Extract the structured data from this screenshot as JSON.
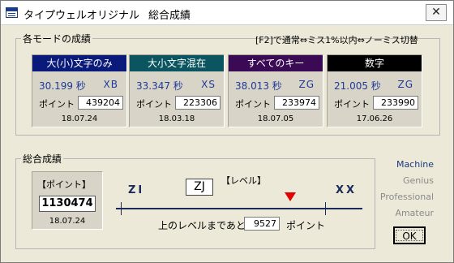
{
  "window": {
    "title": "タイプウェルオリジナル",
    "subtitle": "総合成績",
    "close_glyph": "✕"
  },
  "modes_section": {
    "legend": "各モードの成績",
    "hint": "[F2]で通常⇔ミス1%以内⇔ノーミス切替",
    "point_label": "ポイント",
    "modes": [
      {
        "name": "大(小)文字のみ",
        "header_color": "#0a1a7a",
        "time": "30.199 秒",
        "rank": "XB",
        "points": "439204",
        "date": "18.07.24"
      },
      {
        "name": "大小文字混在",
        "header_color": "#0a5560",
        "time": "33.347 秒",
        "rank": "XS",
        "points": "223306",
        "date": "18.03.18"
      },
      {
        "name": "すべてのキー",
        "header_color": "#3a0a55",
        "time": "38.013 秒",
        "rank": "ZG",
        "points": "233974",
        "date": "18.07.05"
      },
      {
        "name": "数字",
        "header_color": "#000000",
        "time": "21.005 秒",
        "rank": "ZG",
        "points": "233990",
        "date": "17.06.26"
      }
    ]
  },
  "overall_section": {
    "legend": "総合成績",
    "total_label": "【ポイント】",
    "total_points": "1130474",
    "total_date": "18.07.24",
    "level_caption": "【レベル】",
    "current_level": "ZJ",
    "lower_level": "ZI",
    "upper_level": "XX",
    "progress_to_next": 0.83,
    "next_level_prefix": "上のレベルまであと",
    "next_level_points": "9527",
    "next_level_suffix": "ポイント",
    "marker_color": "#e20000"
  },
  "rank_categories": [
    {
      "label": "Machine",
      "color": "#1a3a7a",
      "active": true
    },
    {
      "label": "Genius",
      "color": "#8a8a8a",
      "active": false
    },
    {
      "label": "Professional",
      "color": "#8a8a8a",
      "active": false
    },
    {
      "label": "Amateur",
      "color": "#8a8a8a",
      "active": false
    }
  ],
  "buttons": {
    "ok_label": "OK"
  }
}
